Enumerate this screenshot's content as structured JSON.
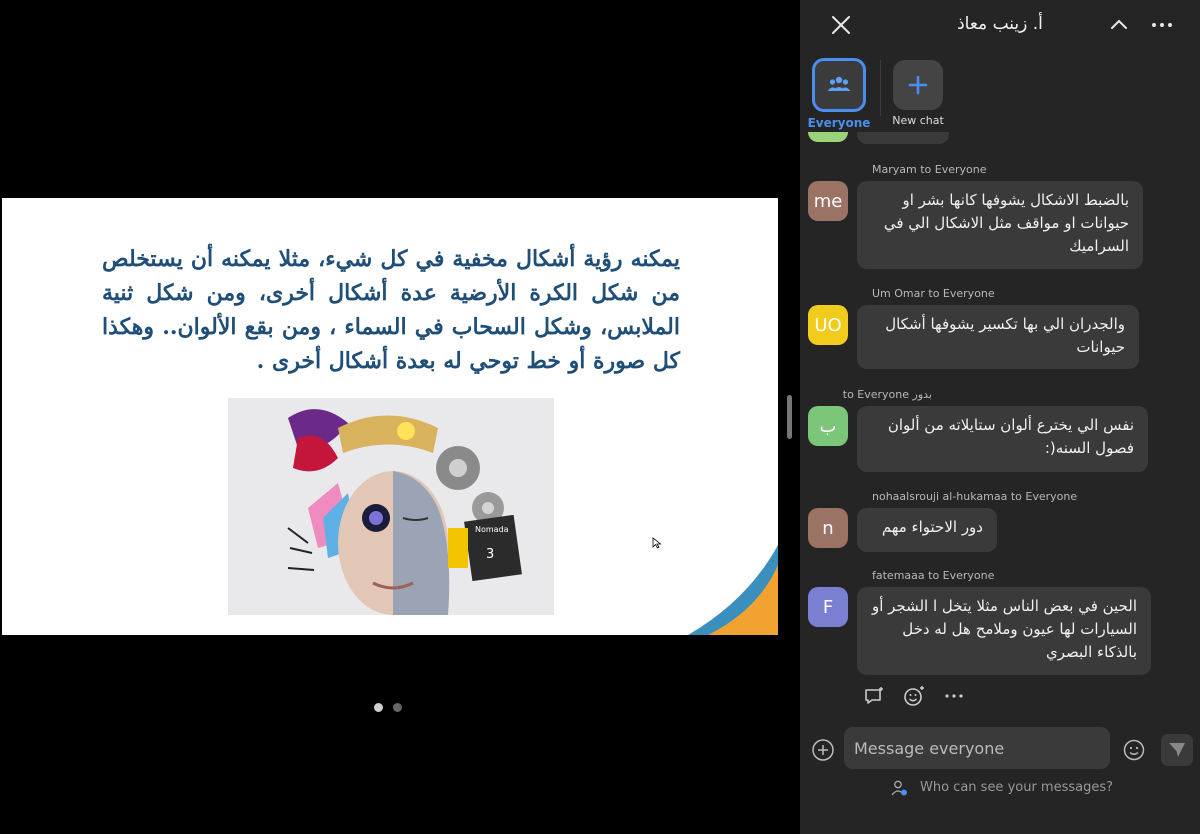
{
  "slide": {
    "text": "يمكنه رؤية أشكال مخفية في كل شيء، مثلا يمكنه أن يستخلص من شكل الكرة الأرضية عدة أشكال أخرى، ومن شكل ثنية الملابس، وشكل السحاب في السماء ، ومن بقع الألوان.. وهكذا كل صورة أو خط توحي له بعدة أشكال أخرى .",
    "image_text": {
      "line1": "Nomada",
      "line2": "3"
    }
  },
  "pager": {
    "current": 1,
    "total": 2
  },
  "chat": {
    "title": "أ. زينب معاذ",
    "targets": [
      {
        "label": "Everyone",
        "icon": "group-icon",
        "selected": true
      },
      {
        "label": "New chat",
        "icon": "plus-icon",
        "selected": false
      }
    ],
    "messages": [
      {
        "sender": "Maryam to Everyone",
        "avatar": "me",
        "avatar_color": "#9b7365",
        "text": "بالضبط الاشكال يشوفها كانها بشر او حيوانات او مواقف مثل الاشكال الي في السراميك"
      },
      {
        "sender": "Um Omar to Everyone",
        "avatar": "UO",
        "avatar_color": "#f2cc1b",
        "text": "والجدران الي بها تكسير يشوفها أشكال حيوانات"
      },
      {
        "sender": "بدور to Everyone",
        "avatar": "ب",
        "avatar_color": "#7cc67a",
        "text": "نفس الي يخترع ألوان ستايلاته من ألوان فصول السنه(:"
      },
      {
        "sender": "nohaalsrouji al-hukamaa to Everyone",
        "avatar": "n",
        "avatar_color": "#9b7365",
        "text": "دور الاحتواء مهم"
      },
      {
        "sender": "fatemaaa to Everyone",
        "avatar": "F",
        "avatar_color": "#7a7fd1",
        "text": "الحين في بعض الناس مثلا يتخل ا الشجر أو السيارات لها عيون وملامح هل له دخل بالذكاء البصري"
      }
    ],
    "composer": {
      "placeholder": "Message everyone"
    },
    "privacy_link": "Who can see your messages?"
  },
  "colors": {
    "accent": "#4a8ff0",
    "slide_text": "#1f4e79",
    "panel_bg": "#252525",
    "bubble_bg": "#3a3a3a"
  }
}
